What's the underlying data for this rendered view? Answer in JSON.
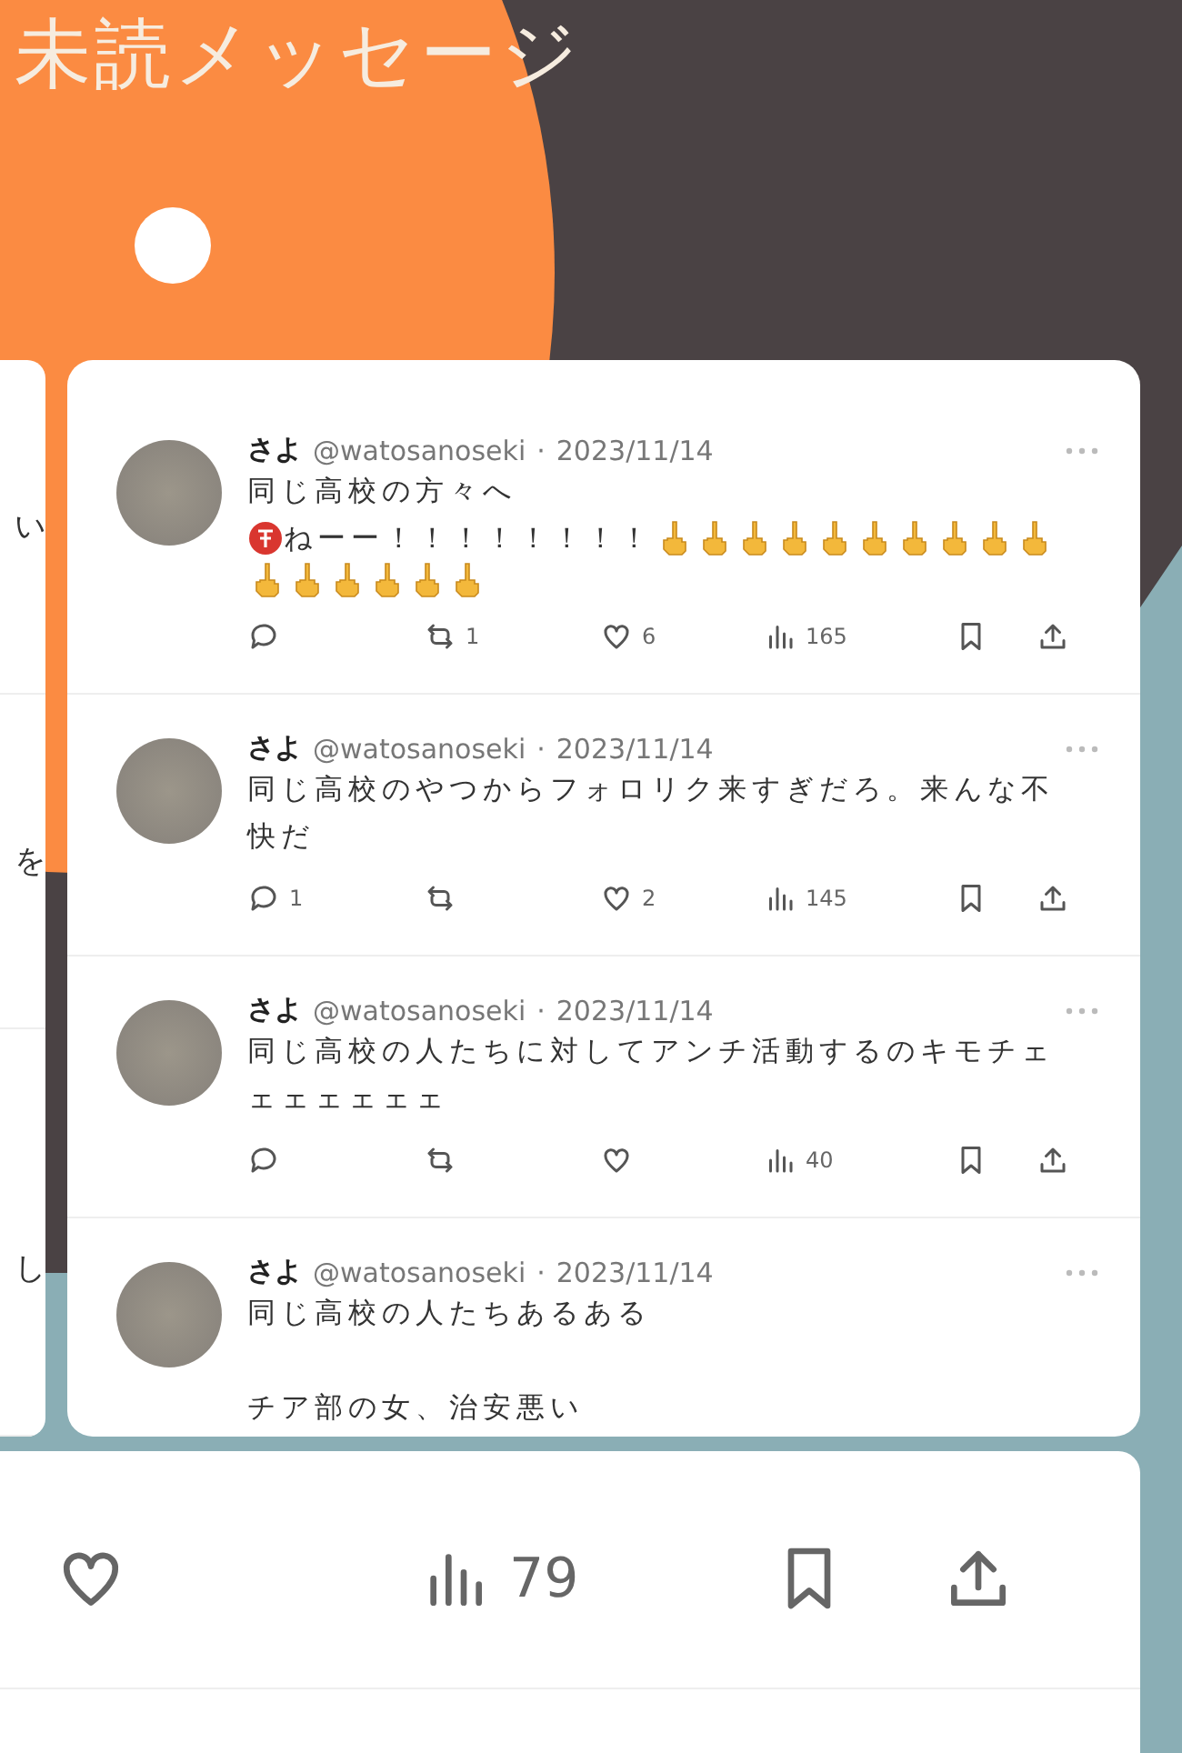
{
  "header": {
    "title": "未読メッセージ"
  },
  "side_card": {
    "fragments": [
      "い",
      "を",
      "し"
    ]
  },
  "tweets": [
    {
      "name": "さよ",
      "handle": "@watosanoseki",
      "separator": "·",
      "date": "2023/11/14",
      "lines": [
        {
          "kind": "text",
          "segments": [
            {
              "kind": "text",
              "text": "同じ高校の方々へ"
            }
          ]
        },
        {
          "kind": "text",
          "segments": [
            {
              "kind": "badge"
            },
            {
              "kind": "text",
              "text": "ねーー！！！！！！！！"
            },
            {
              "kind": "hand"
            },
            {
              "kind": "hand"
            },
            {
              "kind": "hand"
            },
            {
              "kind": "hand"
            },
            {
              "kind": "hand"
            },
            {
              "kind": "hand"
            },
            {
              "kind": "hand"
            },
            {
              "kind": "hand"
            },
            {
              "kind": "hand"
            },
            {
              "kind": "hand"
            },
            {
              "kind": "hand"
            },
            {
              "kind": "hand"
            },
            {
              "kind": "hand"
            },
            {
              "kind": "hand"
            },
            {
              "kind": "hand"
            },
            {
              "kind": "hand"
            }
          ]
        }
      ],
      "retweets": "1",
      "likes": "6",
      "views": "165"
    },
    {
      "name": "さよ",
      "handle": "@watosanoseki",
      "separator": "·",
      "date": "2023/11/14",
      "lines": [
        {
          "kind": "text",
          "segments": [
            {
              "kind": "text",
              "text": "同じ高校のやつからフォロリク来すぎだろ。来んな不快だ"
            }
          ]
        }
      ],
      "replies": "1",
      "likes": "2",
      "views": "145"
    },
    {
      "name": "さよ",
      "handle": "@watosanoseki",
      "separator": "·",
      "date": "2023/11/14",
      "lines": [
        {
          "kind": "text",
          "segments": [
            {
              "kind": "text",
              "text": "同じ高校の人たちに対してアンチ活動するのキモチェェェェェェェ"
            }
          ]
        }
      ],
      "views": "40"
    },
    {
      "name": "さよ",
      "handle": "@watosanoseki",
      "separator": "·",
      "date": "2023/11/14",
      "lines": [
        {
          "kind": "text",
          "segments": [
            {
              "kind": "text",
              "text": "同じ高校の人たちあるある"
            }
          ]
        },
        {
          "kind": "blank"
        },
        {
          "kind": "text",
          "segments": [
            {
              "kind": "text",
              "text": "チア部の女、治安悪い"
            }
          ]
        }
      ]
    }
  ],
  "bottom_card": {
    "views": "79"
  }
}
